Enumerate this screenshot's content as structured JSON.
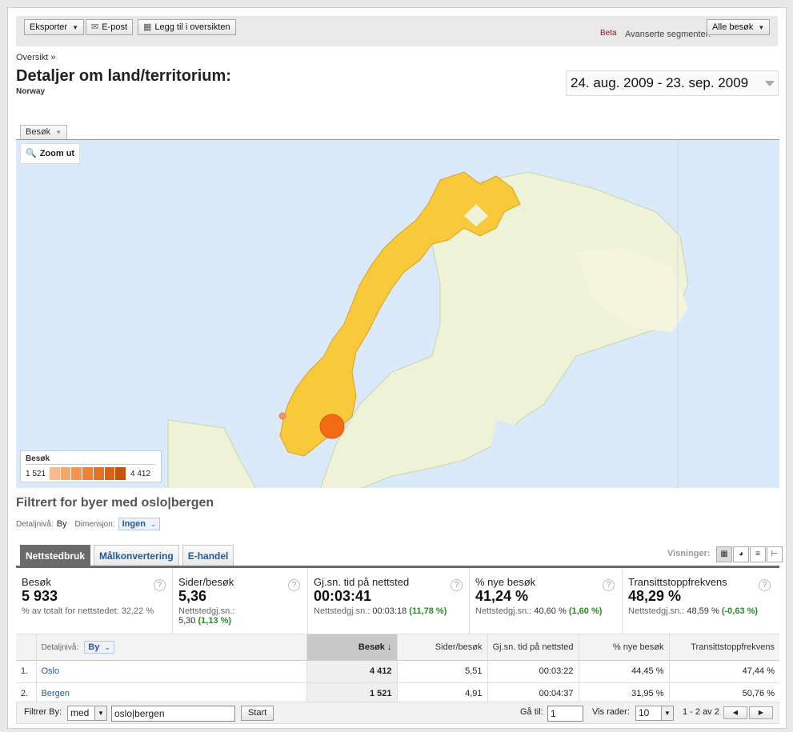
{
  "toolbar": {
    "export_label": "Eksporter",
    "email_label": "E-post",
    "add_dashboard_label": "Legg til i oversikten",
    "beta_label": "Beta",
    "segments_label": "Avanserte segmenter:",
    "segments_value": "Alle besøk"
  },
  "breadcrumb": "Oversikt »",
  "page": {
    "title": "Detaljer om land/territorium:",
    "subtitle": "Norway",
    "date_range": "24. aug. 2009 - 23. sep. 2009"
  },
  "map": {
    "metric_tab": "Besøk",
    "zoom_label": "Zoom ut",
    "legend_title": "Besøk",
    "legend_min": "1 521",
    "legend_max": "4 412",
    "legend_colors": [
      "#f9b98a",
      "#f7a66b",
      "#f5934f",
      "#f08238",
      "#e67122",
      "#d86214",
      "#c4540c"
    ],
    "region_color": "#f8c93a",
    "bubble_color": "#f26a12"
  },
  "filter": {
    "heading": "Filtrert for byer med oslo|bergen",
    "detail_label": "Detaljnivå:",
    "detail_value": "By",
    "dimension_label": "Dimensjon:",
    "dimension_value": "Ingen"
  },
  "tabs": [
    "Nettstedbruk",
    "Målkonvertering",
    "E-handel"
  ],
  "views_label": "Visninger:",
  "metrics": [
    {
      "label": "Besøk",
      "value": "5 933",
      "sub": "% av totalt for nettstedet: 32,22 %"
    },
    {
      "label": "Sider/besøk",
      "value": "5,36",
      "sub_label": "Nettstedgj.sn.:",
      "sub_value": "5,30",
      "sub_delta": "(1,13 %)"
    },
    {
      "label": "Gj.sn. tid på nettsted",
      "value": "00:03:41",
      "sub_label": "Nettstedgj.sn.:",
      "sub_value": "00:03:18",
      "sub_delta": "(11,78 %)"
    },
    {
      "label": "% nye besøk",
      "value": "41,24 %",
      "sub_label": "Nettstedgj.sn.:",
      "sub_value": "40,60 %",
      "sub_delta": "(1,60 %)"
    },
    {
      "label": "Transittstoppfrekvens",
      "value": "48,29 %",
      "sub_label": "Nettstedgj.sn.:",
      "sub_value": "48,59 %",
      "sub_delta": "(-0,63 %)"
    }
  ],
  "table": {
    "detail_label": "Detaljnivå:",
    "detail_value": "By",
    "headers": [
      "Besøk",
      "Sider/besøk",
      "Gj.sn. tid på nettsted",
      "% nye besøk",
      "Transittstoppfrekvens"
    ],
    "rows": [
      {
        "n": "1.",
        "city": "Oslo",
        "visits": "4 412",
        "pages": "5,51",
        "time": "00:03:22",
        "new": "44,45 %",
        "bounce": "47,44 %"
      },
      {
        "n": "2.",
        "city": "Bergen",
        "visits": "1 521",
        "pages": "4,91",
        "time": "00:04:37",
        "new": "31,95 %",
        "bounce": "50,76 %"
      }
    ]
  },
  "footer": {
    "filter_label": "Filtrer By:",
    "filter_op": "med",
    "filter_value": "oslo|bergen",
    "start_label": "Start",
    "goto_label": "Gå til:",
    "goto_value": "1",
    "rows_label": "Vis rader:",
    "rows_value": "10",
    "range": "1 - 2 av 2"
  }
}
